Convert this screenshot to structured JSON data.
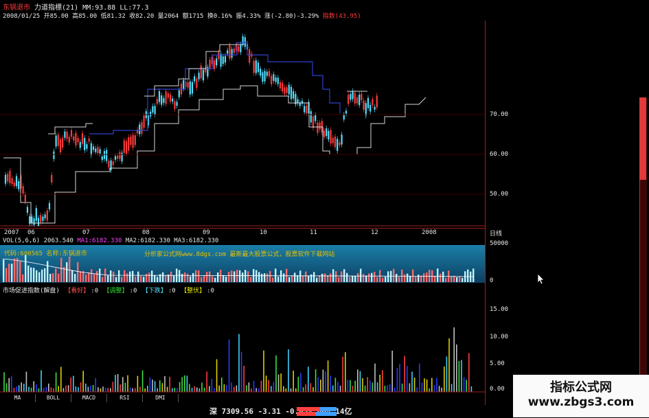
{
  "header": {
    "stock_name": "东锅退市",
    "indicator_name": "力道指標(21)",
    "mm": "MM:93.88",
    "ll": "LL:77.3",
    "date": "2008/01/25",
    "open": "开85.00",
    "high": "高85.00",
    "low": "低81.32",
    "close": "收82.20",
    "volume": "量2064",
    "amount": "额1715",
    "turnover": "换0.16%",
    "amplitude": "振4.33%",
    "change": "涨(-2.80)-3.29%",
    "index_tag": "指数(43.95)"
  },
  "price_axis": {
    "ticks": [
      "70.00",
      "60.00",
      "50.00"
    ],
    "unit": "日线"
  },
  "date_axis": [
    "2007",
    "06",
    "07",
    "08",
    "09",
    "10",
    "11",
    "12",
    "2008"
  ],
  "volume": {
    "label": "VOL(5,6,6)",
    "value": "2063.540",
    "ma1": "MA1:6182.330",
    "ma2": "MA2:6182.330",
    "ma3": "MA3:6182.330",
    "axis_ticks": [
      "50000",
      "0"
    ],
    "overlay_code": "代码:600565",
    "overlay_name": "名称:东锅退市",
    "watermark": "分析家公式网www.8dgs.com 最新最大股票公式，股票软件下载网站"
  },
  "indicator": {
    "label": "市场促进指数(解盘)",
    "items": [
      {
        "name": "【看好】",
        "value": ":0"
      },
      {
        "name": "【调整】",
        "value": ":0"
      },
      {
        "name": "【下跌】",
        "value": ":0"
      },
      {
        "name": "【整伏】",
        "value": ":0"
      }
    ],
    "axis_ticks": [
      "15.00",
      "10.00",
      "5.00",
      "0.00"
    ]
  },
  "tabs": [
    "MA",
    "BOLL",
    "MACD",
    "RSI",
    "DMI"
  ],
  "status": {
    "market": "深",
    "index": "7309.56",
    "change": "-3.31",
    "pct": "-0.05%",
    "amount": "664.14亿"
  },
  "brand": {
    "title": "指标公式网",
    "url": "www.zbgs3.com"
  },
  "colors": {
    "up": "#ff3b3b",
    "down": "#55e0ff",
    "accent": "#e6e600"
  },
  "icons": {
    "cursor": "mouse-pointer-icon"
  }
}
